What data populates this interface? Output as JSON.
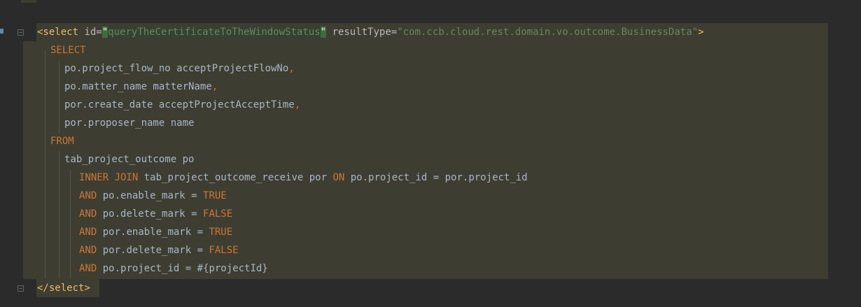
{
  "code": {
    "select_open_tag": "<select",
    "id_attr": " id=",
    "quote_open": "\"",
    "id_value": "queryTheCertificateToTheWindowStatus",
    "quote_close": "\"",
    "result_type_attr": " resultType=",
    "result_type_value": "\"com.ccb.cloud.rest.domain.vo.outcome.BusinessData\"",
    "tag_close": ">",
    "select_kw": "SELECT",
    "col1": "po.project_flow_no acceptProjectFlowNo",
    "col2": "po.matter_name matterName",
    "col3": "por.create_date acceptProjectAcceptTime",
    "col4": "por.proposer_name name",
    "comma": ",",
    "from_kw": "FROM",
    "table": "tab_project_outcome po",
    "inner_join_kw": "INNER JOIN",
    "join_table": " tab_project_outcome_receive por ",
    "on_kw": "ON",
    "join_cond": " po.project_id = por.project_id",
    "and_kw": "AND",
    "cond1": " po.enable_mark = ",
    "cond2": " po.delete_mark = ",
    "cond3": " por.enable_mark = ",
    "cond4": " por.delete_mark = ",
    "cond5": " po.project_id = #{projectId}",
    "true_kw": "TRUE",
    "false_kw": "FALSE",
    "select_close_tag": "</select>"
  }
}
